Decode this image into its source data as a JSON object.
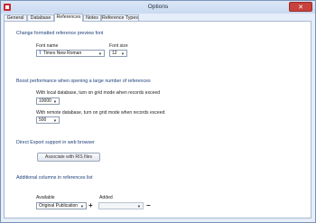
{
  "window": {
    "title": "Options",
    "close_glyph": "✕"
  },
  "tabs": [
    {
      "label": "General"
    },
    {
      "label": "Database"
    },
    {
      "label": "References",
      "active": true
    },
    {
      "label": "Notes"
    },
    {
      "label": "Reference Types"
    }
  ],
  "preview_font": {
    "heading": "Change formatted reference preview font",
    "font_name_label": "Font name",
    "font_name_value": "Times New Roman",
    "font_size_label": "Font size",
    "font_size_value": "12"
  },
  "performance": {
    "heading": "Boost performance when opening a large number of references",
    "local_label": "With local database, turn on grid mode when records exceed",
    "local_value": "10000",
    "remote_label": "With remote database, turn on grid mode when records exceed",
    "remote_value": "500"
  },
  "direct_export": {
    "heading": "Direct Export support in web browser",
    "button_label": "Associate with RIS files"
  },
  "columns": {
    "heading": "Additional columns in references list",
    "available_label": "Available",
    "available_value": "Original Publication",
    "added_label": "Added",
    "added_value": "",
    "add_glyph": "+",
    "remove_glyph": "−"
  },
  "icons": {
    "app": "app-icon",
    "font": "font-icon",
    "dropdown": "chevron-down-icon"
  },
  "colors": {
    "section_heading": "#1b3f7a",
    "close_button": "#c7423c",
    "window_frame": "#7a93b8"
  }
}
